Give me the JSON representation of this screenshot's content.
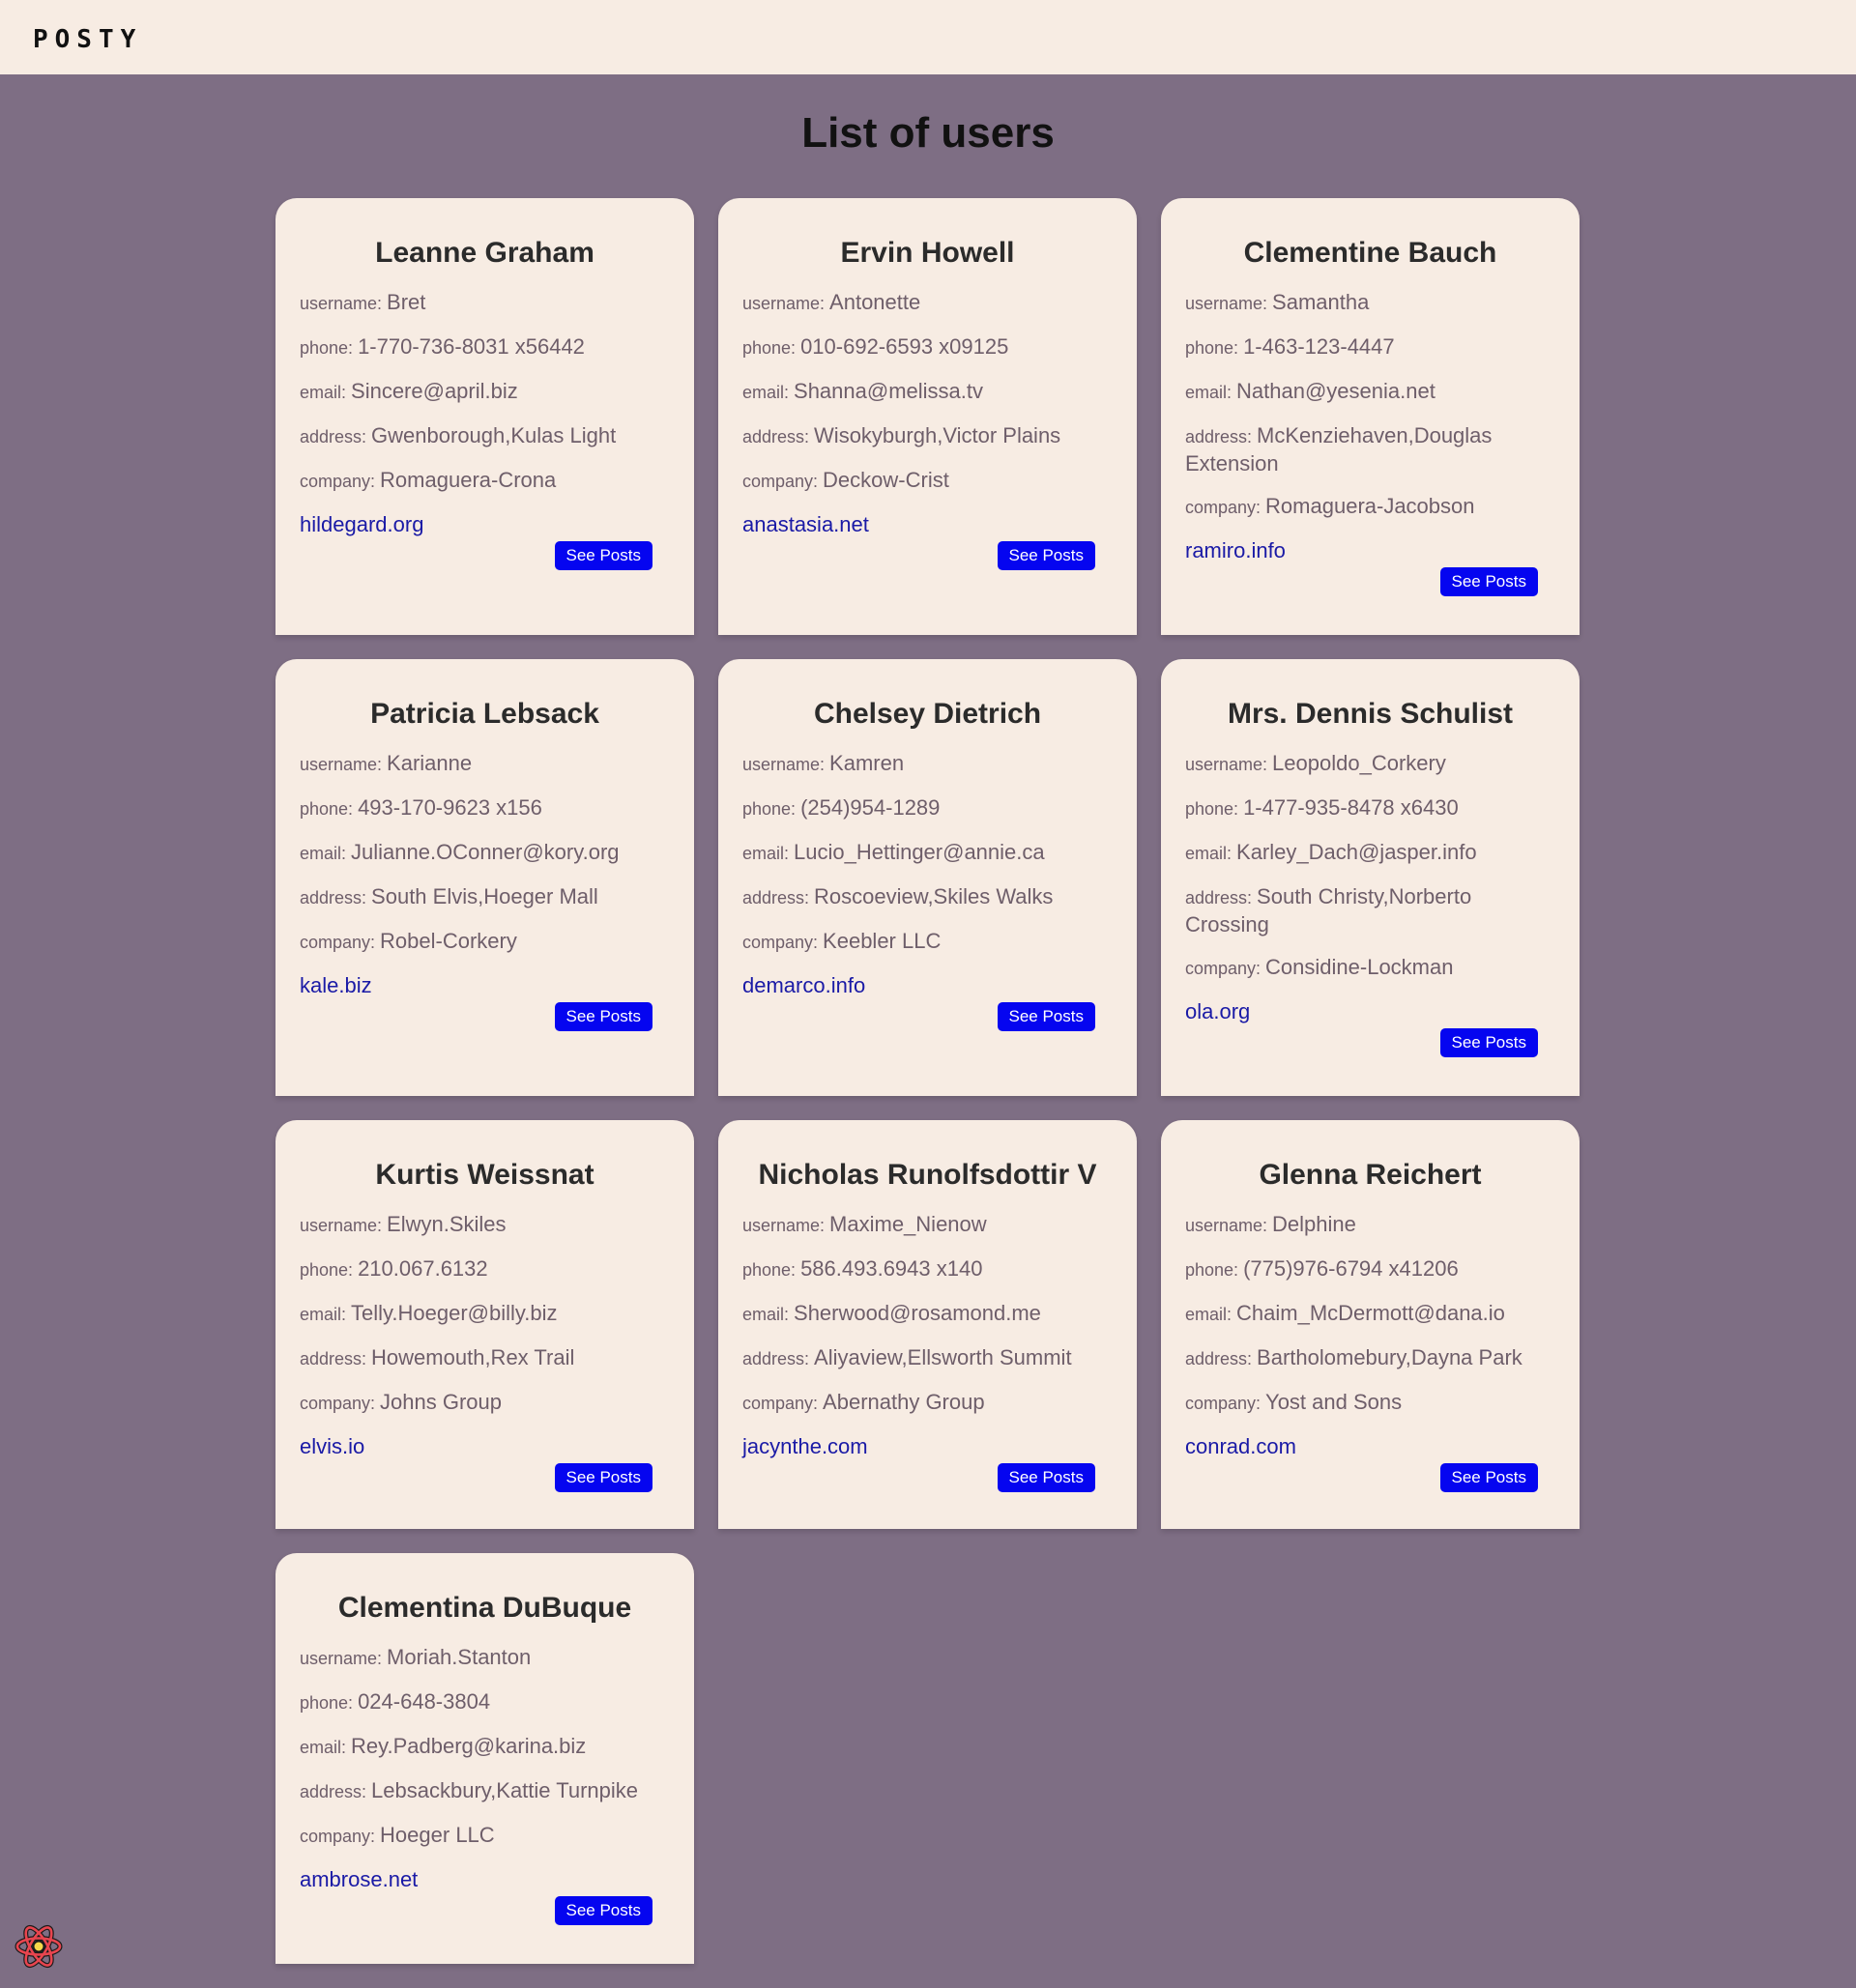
{
  "app": {
    "logo": "POSTY"
  },
  "page": {
    "title": "List of users"
  },
  "labels": {
    "username": "username: ",
    "phone": "phone: ",
    "email": "email: ",
    "address": "address: ",
    "company": "company: ",
    "button": "See Posts"
  },
  "users": [
    {
      "name": "Leanne Graham",
      "username": "Bret",
      "phone": "1-770-736-8031 x56442",
      "email": "Sincere@april.biz",
      "address": "Gwenborough,Kulas Light",
      "company": "Romaguera-Crona",
      "website": "hildegard.org"
    },
    {
      "name": "Ervin Howell",
      "username": "Antonette",
      "phone": "010-692-6593 x09125",
      "email": "Shanna@melissa.tv",
      "address": "Wisokyburgh,Victor Plains",
      "company": "Deckow-Crist",
      "website": "anastasia.net"
    },
    {
      "name": "Clementine Bauch",
      "username": "Samantha",
      "phone": "1-463-123-4447",
      "email": "Nathan@yesenia.net",
      "address": "McKenziehaven,Douglas Extension",
      "company": "Romaguera-Jacobson",
      "website": "ramiro.info"
    },
    {
      "name": "Patricia Lebsack",
      "username": "Karianne",
      "phone": "493-170-9623 x156",
      "email": "Julianne.OConner@kory.org",
      "address": "South Elvis,Hoeger Mall",
      "company": "Robel-Corkery",
      "website": "kale.biz"
    },
    {
      "name": "Chelsey Dietrich",
      "username": "Kamren",
      "phone": "(254)954-1289",
      "email": "Lucio_Hettinger@annie.ca",
      "address": "Roscoeview,Skiles Walks",
      "company": "Keebler LLC",
      "website": "demarco.info"
    },
    {
      "name": "Mrs. Dennis Schulist",
      "username": "Leopoldo_Corkery",
      "phone": "1-477-935-8478 x6430",
      "email": "Karley_Dach@jasper.info",
      "address": "South Christy,Norberto Crossing",
      "company": "Considine-Lockman",
      "website": "ola.org"
    },
    {
      "name": "Kurtis Weissnat",
      "username": "Elwyn.Skiles",
      "phone": "210.067.6132",
      "email": "Telly.Hoeger@billy.biz",
      "address": "Howemouth,Rex Trail",
      "company": "Johns Group",
      "website": "elvis.io"
    },
    {
      "name": "Nicholas Runolfsdottir V",
      "username": "Maxime_Nienow",
      "phone": "586.493.6943 x140",
      "email": "Sherwood@rosamond.me",
      "address": "Aliyaview,Ellsworth Summit",
      "company": "Abernathy Group",
      "website": "jacynthe.com"
    },
    {
      "name": "Glenna Reichert",
      "username": "Delphine",
      "phone": "(775)976-6794 x41206",
      "email": "Chaim_McDermott@dana.io",
      "address": "Bartholomebury,Dayna Park",
      "company": "Yost and Sons",
      "website": "conrad.com"
    },
    {
      "name": "Clementina DuBuque",
      "username": "Moriah.Stanton",
      "phone": "024-648-3804",
      "email": "Rey.Padberg@karina.biz",
      "address": "Lebsackbury,Kattie Turnpike",
      "company": "Hoeger LLC",
      "website": "ambrose.net"
    }
  ],
  "devtools_icon": "react-icon"
}
